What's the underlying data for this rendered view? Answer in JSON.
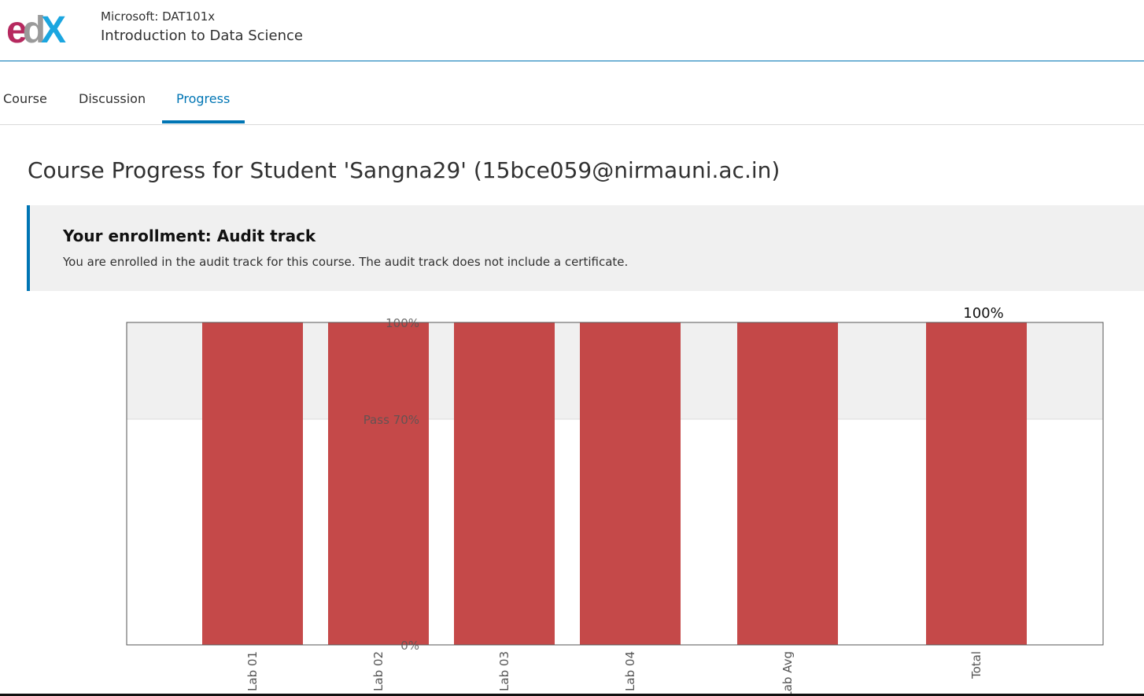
{
  "header": {
    "logo_text": "edX",
    "course_org": "Microsoft: DAT101x",
    "course_name": "Introduction to Data Science"
  },
  "tabs": [
    {
      "label": "Course",
      "active": false
    },
    {
      "label": "Discussion",
      "active": false
    },
    {
      "label": "Progress",
      "active": true
    }
  ],
  "page": {
    "title": "Course Progress for Student 'Sangna29' (15bce059@nirmauni.ac.in)"
  },
  "banner": {
    "title": "Your enrollment: Audit track",
    "text": "You are enrolled in the audit track for this course. The audit track does not include a certificate."
  },
  "colors": {
    "accent": "#0075b4",
    "bar": "#c0393a",
    "pass_band": "#f0f0f0"
  },
  "chart_data": {
    "type": "bar",
    "categories": [
      "Lab 01",
      "Lab 02",
      "Lab 03",
      "Lab 04",
      "Lab Avg",
      "Total"
    ],
    "values": [
      100,
      100,
      100,
      100,
      100,
      100
    ],
    "ylim": [
      0,
      100
    ],
    "y_tick_labels": [
      {
        "value": 100,
        "label": "100%"
      },
      {
        "value": 70,
        "label": "Pass 70%"
      },
      {
        "value": 0,
        "label": "0%"
      }
    ],
    "pass_threshold": 70,
    "total_label": "100%"
  }
}
